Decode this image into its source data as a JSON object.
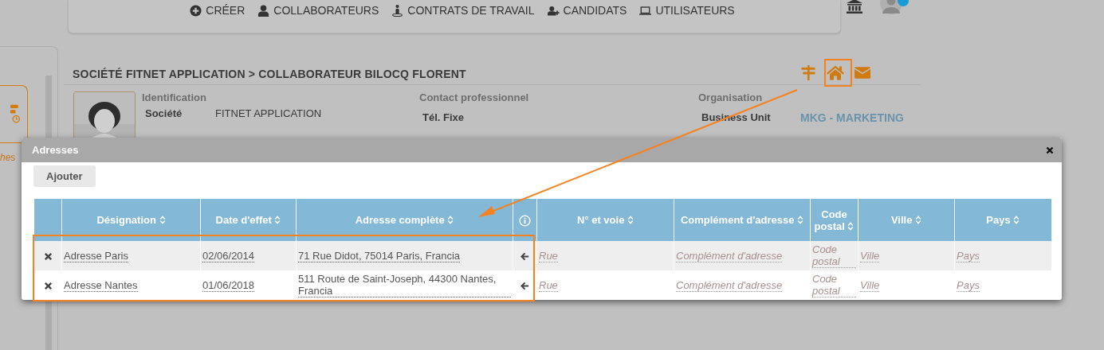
{
  "top_nav": {
    "items": [
      {
        "label": "CRÉER"
      },
      {
        "label": "COLLABORATEURS"
      },
      {
        "label": "CONTRATS DE TRAVAIL"
      },
      {
        "label": "CANDIDATS"
      },
      {
        "label": "UTILISATEURS"
      }
    ]
  },
  "sidebar": {
    "partial_label": "hes"
  },
  "breadcrumb": "SOCIÉTÉ FITNET APPLICATION > COLLABORATEUR BILOCQ FLORENT",
  "profile": {
    "sections": [
      {
        "heading": "Identification",
        "fields": [
          {
            "label": "Société",
            "value": "FITNET APPLICATION"
          }
        ]
      },
      {
        "heading": "Contact professionnel",
        "fields": [
          {
            "label": "Tél. Fixe"
          }
        ]
      },
      {
        "heading": "Organisation",
        "fields": [
          {
            "label": "Business Unit",
            "value": "MKG - MARKETING"
          }
        ]
      }
    ]
  },
  "dialog": {
    "title": "Adresses",
    "add_button": "Ajouter",
    "table": {
      "columns": [
        {
          "kind": "blank"
        },
        {
          "kind": "sort",
          "label": "Désignation"
        },
        {
          "kind": "sort",
          "label": "Date d'effet"
        },
        {
          "kind": "sort",
          "label": "Adresse complète"
        },
        {
          "kind": "info"
        },
        {
          "kind": "sort",
          "label": "N° et voie"
        },
        {
          "kind": "sort",
          "label": "Complément d'adresse"
        },
        {
          "kind": "sort",
          "label": "Code postal"
        },
        {
          "kind": "sort",
          "label": "Ville"
        },
        {
          "kind": "sort",
          "label": "Pays"
        }
      ],
      "rows": [
        {
          "designation": "Adresse Paris",
          "date": "02/06/2014",
          "address": "71 Rue Didot, 75014 Paris, Francia",
          "street": {
            "placeholder": "Rue"
          },
          "complement": {
            "placeholder": "Complément d'adresse"
          },
          "postal_code": {
            "placeholder": "Code postal"
          },
          "city": {
            "placeholder": "Ville"
          },
          "country": {
            "placeholder": "Pays"
          }
        },
        {
          "designation": "Adresse Nantes",
          "date": "01/06/2018",
          "address": "511 Route de Saint-Joseph, 44300 Nantes, Francia",
          "street": {
            "placeholder": "Rue"
          },
          "complement": {
            "placeholder": "Complément d'adresse"
          },
          "postal_code": {
            "placeholder": "Code postal"
          },
          "city": {
            "placeholder": "Ville"
          },
          "country": {
            "placeholder": "Pays"
          }
        }
      ]
    }
  }
}
